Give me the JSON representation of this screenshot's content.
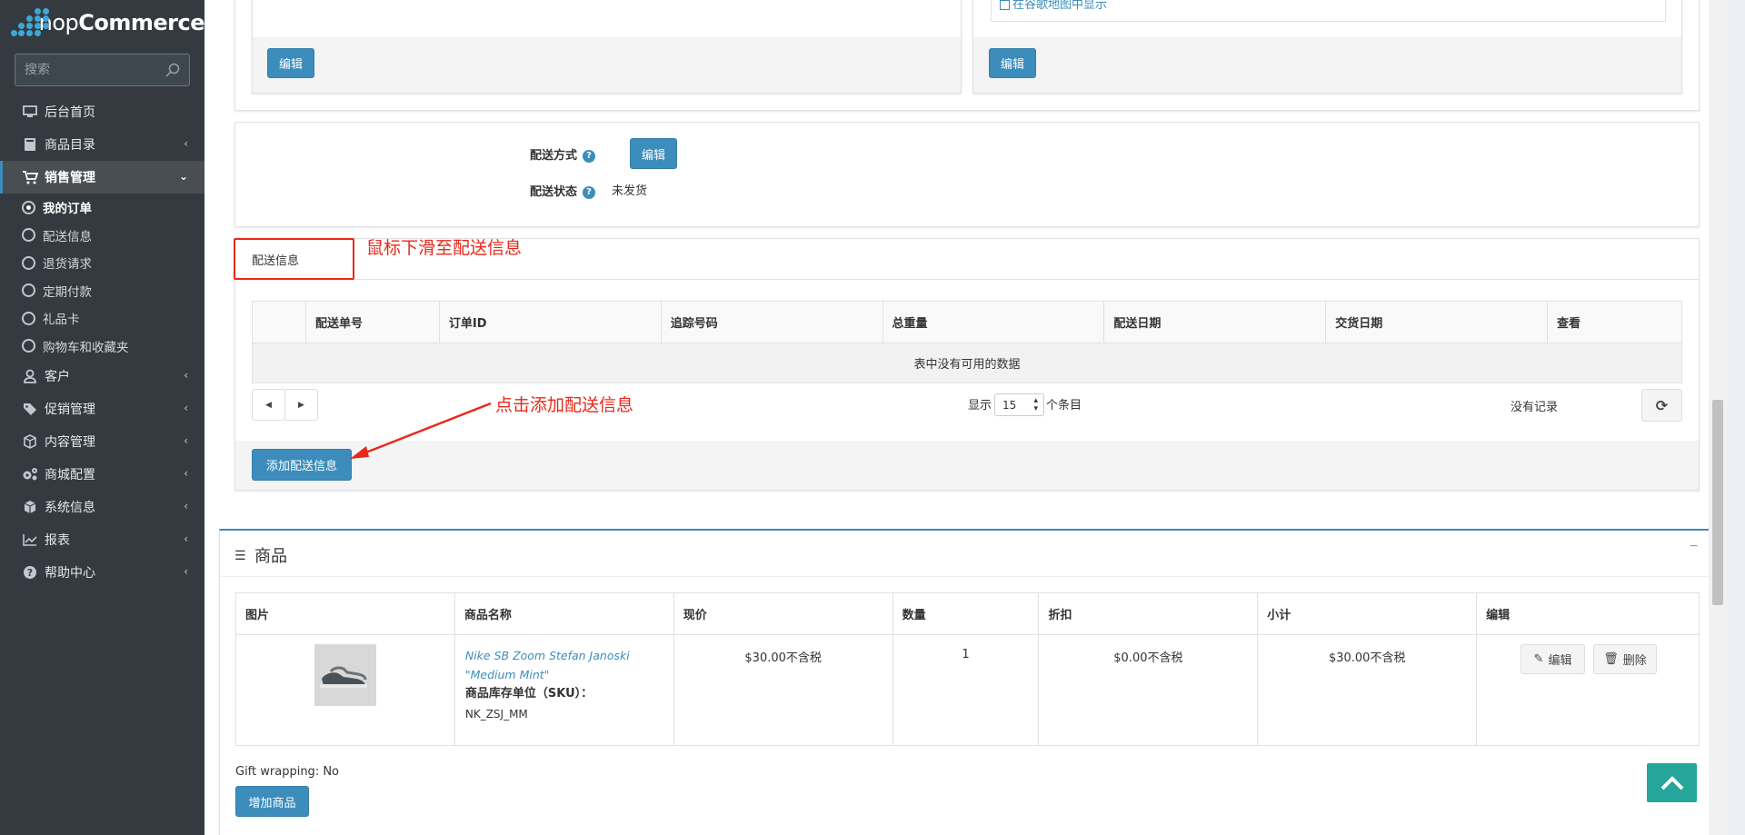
{
  "brand": {
    "name_light": "nop",
    "name_bold": "Commerce",
    "logo_color": "#3fa7d6"
  },
  "sidebar": {
    "search_placeholder": "搜索",
    "items": [
      {
        "label": "后台首页",
        "icon": "monitor-icon"
      },
      {
        "label": "商品目录",
        "icon": "book-icon"
      },
      {
        "label": "销售管理",
        "icon": "cart-icon",
        "active": true
      },
      {
        "label": "客户",
        "icon": "user-icon"
      },
      {
        "label": "促销管理",
        "icon": "tag-icon"
      },
      {
        "label": "内容管理",
        "icon": "cube-icon"
      },
      {
        "label": "商城配置",
        "icon": "gears-icon"
      },
      {
        "label": "系统信息",
        "icon": "cube-icon"
      },
      {
        "label": "报表",
        "icon": "chart-icon"
      },
      {
        "label": "帮助中心",
        "icon": "question-icon"
      }
    ],
    "sub_items": [
      {
        "label": "我的订单",
        "active": true
      },
      {
        "label": "配送信息"
      },
      {
        "label": "退货请求"
      },
      {
        "label": "定期付款"
      },
      {
        "label": "礼品卡"
      },
      {
        "label": "购物车和收藏夹"
      }
    ]
  },
  "address_card": {
    "map_link": "在谷歌地图中显示",
    "edit_left": "编辑",
    "edit_right": "编辑"
  },
  "shipping_method": {
    "label": "配送方式",
    "edit": "编辑",
    "status_label": "配送状态",
    "status_value": "未发货"
  },
  "shipments": {
    "tab_label": "配送信息",
    "annotation_scroll": "鼠标下滑至配送信息",
    "annotation_add": "点击添加配送信息",
    "columns": [
      "配送单号",
      "订单ID",
      "追踪号码",
      "总重量",
      "配送日期",
      "交货日期",
      "查看"
    ],
    "empty_text": "表中没有可用的数据",
    "show_label": "显示",
    "page_size": "15",
    "items_label": "个条目",
    "no_records": "没有记录",
    "add_button": "添加配送信息"
  },
  "products": {
    "title": "商品",
    "columns": [
      "图片",
      "商品名称",
      "现价",
      "数量",
      "折扣",
      "小计",
      "编辑"
    ],
    "rows": [
      {
        "name": "Nike SB Zoom Stefan Janoski \"Medium Mint\"",
        "sku_label": "商品库存单位（SKU）：",
        "sku": "NK_ZSJ_MM",
        "price": "$30.00不含税",
        "quantity": "1",
        "discount": "$0.00不含税",
        "subtotal": "$30.00不含税",
        "edit": "编辑",
        "delete": "删除"
      }
    ],
    "gift_wrapping": "Gift wrapping: No",
    "add_button": "增加商品"
  },
  "colors": {
    "primary": "#3c8dbc",
    "annotation": "#e8281c",
    "sidebar_bg": "#343a40",
    "back_to_top": "#26a69a"
  }
}
